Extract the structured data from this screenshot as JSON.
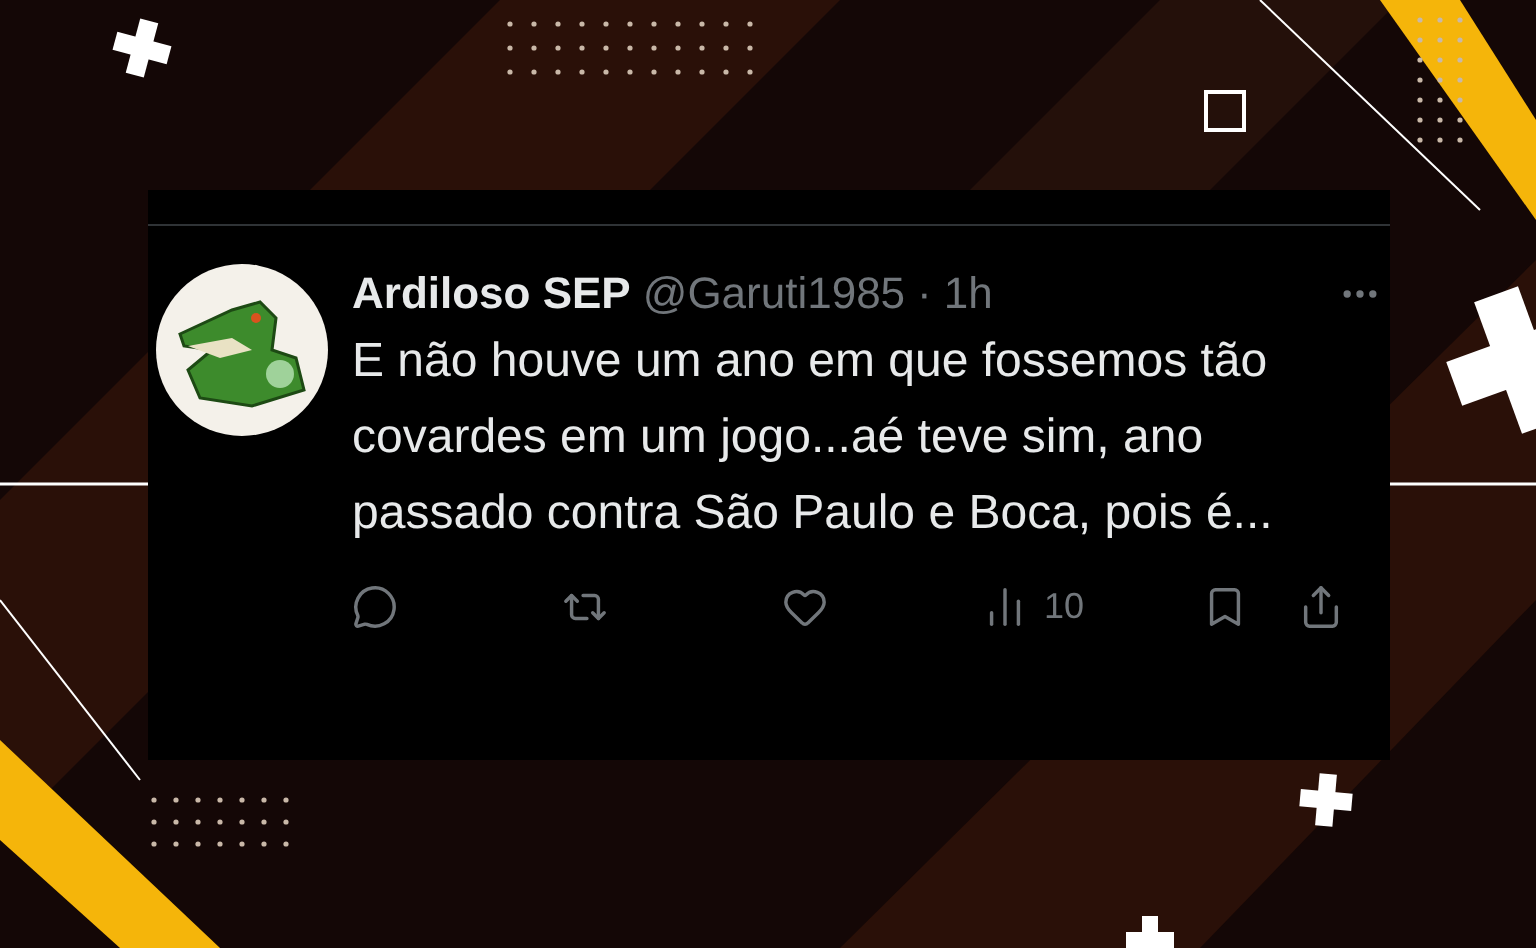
{
  "tweet": {
    "name": "Ardiloso SEP",
    "handle": "@Garuti1985",
    "separator": "·",
    "time": "1h",
    "text": "E não houve um ano em que fossemos tão covardes em um jogo...aé teve sim, ano passado contra São Paulo e Boca, pois é...",
    "actions": [
      {
        "kind": "reply"
      },
      {
        "kind": "repost"
      },
      {
        "kind": "like"
      },
      {
        "kind": "views",
        "count": "10"
      },
      {
        "kind": "bookmark"
      },
      {
        "kind": "share"
      }
    ]
  }
}
